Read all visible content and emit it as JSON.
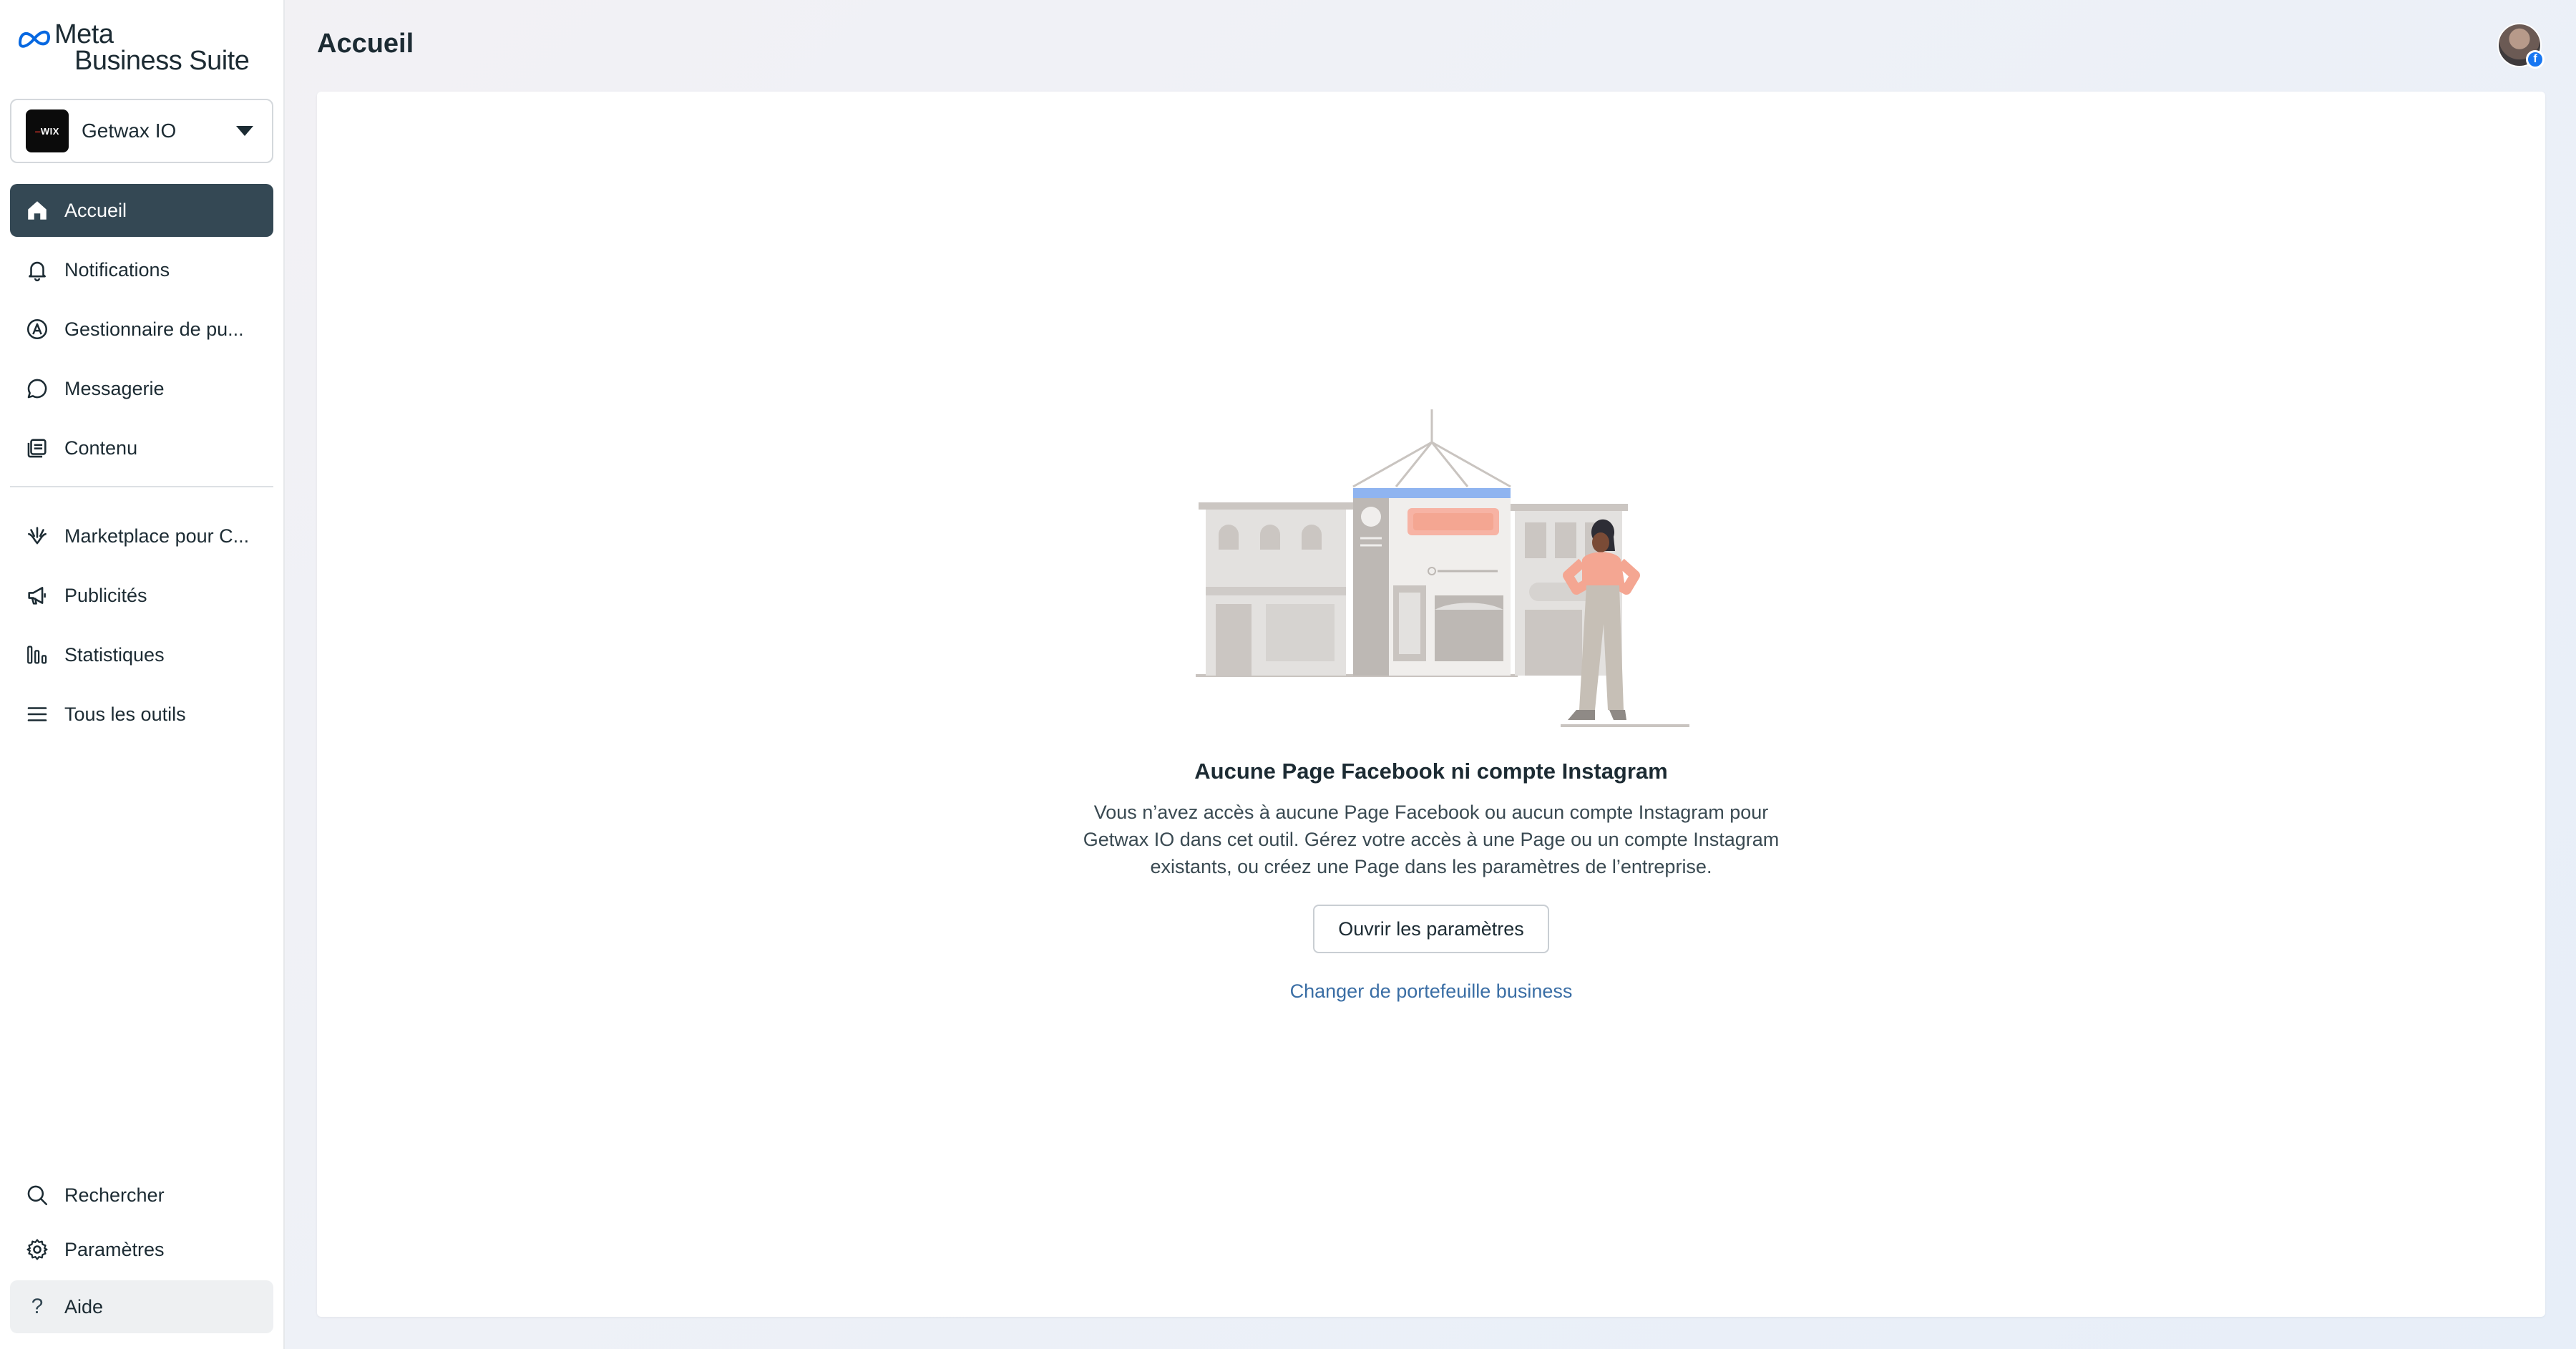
{
  "app": {
    "logo_line1": "Meta",
    "logo_line2": "Business Suite"
  },
  "account": {
    "name": "Getwax IO",
    "avatar_text": "WIX"
  },
  "nav": {
    "items": [
      {
        "label": "Accueil",
        "icon": "home-icon",
        "active": true
      },
      {
        "label": "Notifications",
        "icon": "bell-icon"
      },
      {
        "label": "Gestionnaire de pu...",
        "icon": "manager-icon"
      },
      {
        "label": "Messagerie",
        "icon": "chat-bubble-icon"
      },
      {
        "label": "Contenu",
        "icon": "content-icon"
      }
    ],
    "items2": [
      {
        "label": "Marketplace pour C...",
        "icon": "marketplace-icon"
      },
      {
        "label": "Publicités",
        "icon": "megaphone-icon"
      },
      {
        "label": "Statistiques",
        "icon": "bar-chart-icon"
      },
      {
        "label": "Tous les outils",
        "icon": "menu-icon"
      }
    ],
    "bottom": [
      {
        "label": "Rechercher",
        "icon": "search-icon"
      },
      {
        "label": "Paramètres",
        "icon": "gear-icon"
      },
      {
        "label": "Aide",
        "icon": "help-icon"
      }
    ]
  },
  "header": {
    "title": "Accueil"
  },
  "empty_state": {
    "title": "Aucune Page Facebook ni compte Instagram",
    "description": "Vous n’avez accès à aucune Page Facebook ou aucun compte Instagram pour Getwax IO dans cet outil. Gérez votre accès à une Page ou un compte Instagram existants, ou créez une Page dans les paramètres de l’entreprise.",
    "button_label": "Ouvrir les paramètres",
    "link_label": "Changer de portefeuille business"
  },
  "colors": {
    "active_nav_bg": "#344854",
    "link": "#3a6ea5",
    "facebook_blue": "#1877f2"
  }
}
